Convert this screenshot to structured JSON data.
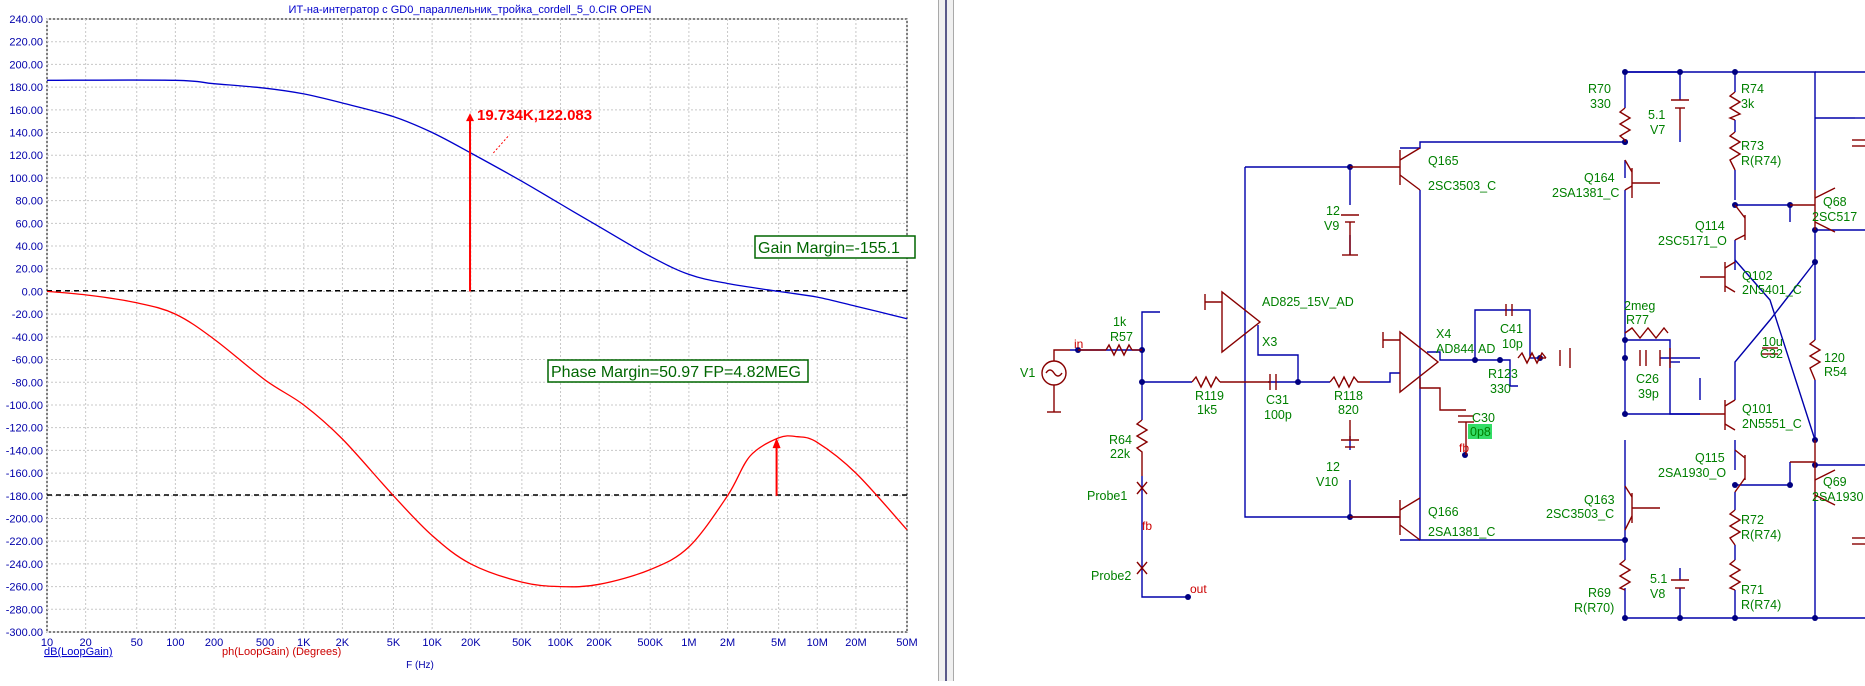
{
  "window": {
    "plot_title": "ИТ-на-интегратор с GD0_параллельник_тройка_cordell_5_0.CIR OPEN"
  },
  "colors": {
    "gain_trace": "#0000cc",
    "phase_trace": "#ff0000",
    "margin_text": "#006600",
    "schematic_wire": "#0000aa",
    "schematic_component": "#880000",
    "schematic_label": "#008000"
  },
  "plot": {
    "x_axis_title": "F (Hz)",
    "legend_gain": "dB(LoopGain)",
    "legend_phase": "ph(LoopGain) (Degrees)",
    "cursor_label": "19.734K,122.083",
    "gain_margin_label": "Gain Margin=-155.1",
    "phase_margin_label": "Phase Margin=50.97 FP=4.82MEG",
    "y_ticks": [
      "240.00",
      "220.00",
      "200.00",
      "180.00",
      "160.00",
      "140.00",
      "120.00",
      "100.00",
      "80.00",
      "60.00",
      "40.00",
      "20.00",
      "0.00",
      "-20.00",
      "-40.00",
      "-60.00",
      "-80.00",
      "-100.00",
      "-120.00",
      "-140.00",
      "-160.00",
      "-180.00",
      "-200.00",
      "-220.00",
      "-240.00",
      "-260.00",
      "-280.00",
      "-300.00"
    ],
    "x_ticks": [
      "10",
      "20",
      "50",
      "100",
      "200",
      "500",
      "1K",
      "2K",
      "5K",
      "10K",
      "20K",
      "50K",
      "100K",
      "200K",
      "500K",
      "1M",
      "2M",
      "5M",
      "10M",
      "20M",
      "50M"
    ]
  },
  "chart_data": {
    "type": "line",
    "title": "ИТ-на-интегратор с GD0_параллельник_тройка_cordell_5_0.CIR OPEN",
    "xlabel": "F (Hz)",
    "x_scale": "log",
    "xlim": [
      10,
      50000000
    ],
    "ylim": [
      -300,
      240
    ],
    "grid": true,
    "legend": "bottom-left",
    "series": [
      {
        "name": "dB(LoopGain)",
        "x": [
          10,
          100,
          200,
          500,
          1000,
          2000,
          5000,
          10000,
          20000,
          50000,
          100000,
          200000,
          500000,
          1000000,
          2000000,
          5000000,
          10000000,
          20000000,
          50000000
        ],
        "y": [
          186,
          186,
          183,
          179,
          174,
          166,
          154,
          140,
          122,
          97,
          77,
          57,
          31,
          15,
          7,
          0,
          -5,
          -13,
          -24
        ]
      },
      {
        "name": "ph(LoopGain) (Degrees)",
        "x": [
          10,
          20,
          50,
          100,
          200,
          500,
          1000,
          2000,
          5000,
          10000,
          20000,
          50000,
          100000,
          200000,
          500000,
          1000000,
          2000000,
          3000000,
          5000000,
          7000000,
          10000000,
          20000000,
          50000000
        ],
        "y": [
          0,
          -3,
          -10,
          -20,
          -42,
          -78,
          -100,
          -130,
          -180,
          -215,
          -240,
          -256,
          -260,
          -258,
          -245,
          -225,
          -180,
          -145,
          -129,
          -128,
          -133,
          -160,
          -210
        ]
      }
    ],
    "annotations": [
      {
        "text": "19.734K,122.083",
        "x": 19734,
        "y": 122.083
      },
      {
        "text": "Gain Margin=-155.1",
        "x": 5000000,
        "y": 0
      },
      {
        "text": "Phase Margin=50.97 FP=4.82MEG",
        "x": 4820000,
        "y": -180
      }
    ]
  },
  "schematic": {
    "labels": {
      "v1": "V1",
      "in": "in",
      "r57": "R57",
      "r57v": "1k",
      "r119": "R119",
      "r119v": "1k5",
      "c31": "C31",
      "c31v": "100p",
      "r118": "R118",
      "r118v": "820",
      "r64": "R64",
      "r64v": "22k",
      "probe1": "Probe1",
      "fb": "fb",
      "probe2": "Probe2",
      "out": "out",
      "x3": "X3",
      "x3m": "AD825_15V_AD",
      "x4": "X4",
      "x4m": "AD844",
      "ad": "AD",
      "c41": "C41",
      "c41v": "10p",
      "r123": "R123",
      "r123v": "330",
      "c30": "C30",
      "c30v": "0p8",
      "fb2": "fb",
      "v9v": "12",
      "v9": "V9",
      "v10v": "12",
      "v10": "V10",
      "q165": "Q165",
      "q165m": "2SC3503_C",
      "q166": "Q166",
      "q166m": "2SA1381_C",
      "r70": "R70",
      "r70v": "330",
      "v7v": "5.1",
      "v7": "V7",
      "q164": "Q164",
      "q164m": "2SA1381_C",
      "r77v": "2meg",
      "r77": "R77",
      "c26": "C26",
      "c26v": "39p",
      "q163": "Q163",
      "q163m": "2SC3503_C",
      "v8v": "5.1",
      "v8": "V8",
      "r69": "R69",
      "r69v": "R(R70)",
      "r74": "R74",
      "r74v": "3k",
      "r73": "R73",
      "r73v": "R(R74)",
      "q114": "Q114",
      "q114m": "2SC5171_O",
      "q102": "Q102",
      "q102m": "2N5401_C",
      "c32v": "10u",
      "c32": "C32",
      "r54v": "120",
      "r54": "R54",
      "q101": "Q101",
      "q101m": "2N5551_C",
      "q115": "Q115",
      "q115m": "2SA1930_O",
      "r72": "R72",
      "r72v": "R(R74)",
      "r71": "R71",
      "r71v": "R(R74)",
      "q68": "Q68",
      "q68m": "2SC517",
      "q69": "Q69",
      "q69m": "2SA1930"
    }
  }
}
